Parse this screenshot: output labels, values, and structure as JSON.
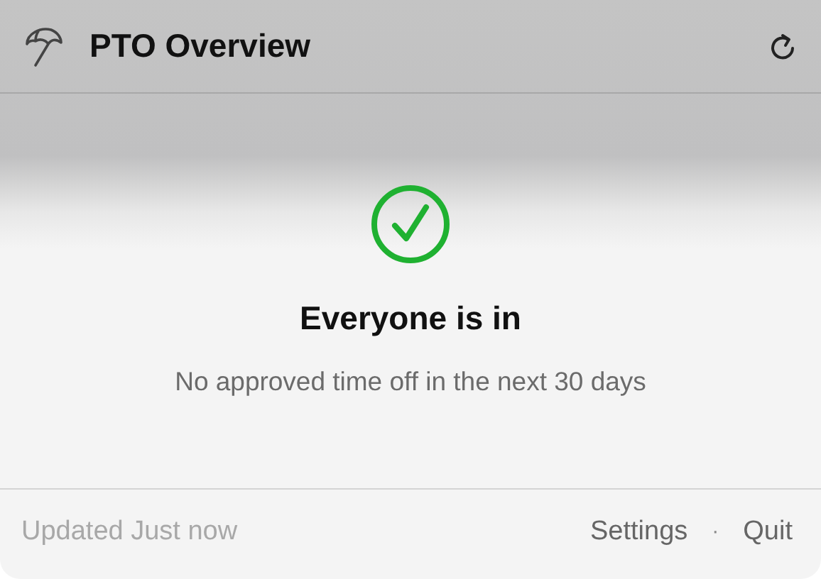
{
  "header": {
    "title": "PTO Overview"
  },
  "status": {
    "kind": "all-in",
    "title": "Everyone is in",
    "message": "No approved time off in the next 30 days"
  },
  "footer": {
    "updated": "Updated Just now",
    "links": [
      "Settings",
      "Quit"
    ],
    "separator": "·"
  }
}
